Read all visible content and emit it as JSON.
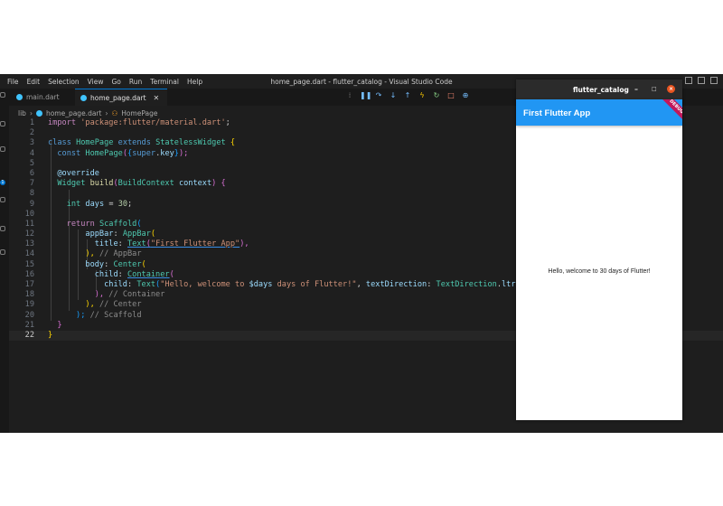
{
  "menu": [
    "File",
    "Edit",
    "Selection",
    "View",
    "Go",
    "Run",
    "Terminal",
    "Help"
  ],
  "window_title": "home_page.dart - flutter_catalog - Visual Studio Code",
  "tabs": [
    {
      "label": "main.dart",
      "icon": "dart-icon"
    },
    {
      "label": "home_page.dart",
      "icon": "dart-icon",
      "active": true
    }
  ],
  "activity_badge": "1",
  "breadcrumb": {
    "folder": "lib",
    "file": "home_page.dart",
    "symbol": "HomePage"
  },
  "editor": {
    "current_line": 22
  },
  "line_numbers": [
    "1",
    "2",
    "3",
    "4",
    "5",
    "6",
    "7",
    "8",
    "9",
    "10",
    "11",
    "12",
    "13",
    "14",
    "15",
    "16",
    "17",
    "18",
    "19",
    "20",
    "21",
    "22"
  ],
  "code_tokens": {
    "l1": [
      "import",
      "'package:flutter/material.dart'",
      ";"
    ],
    "l3": [
      "class",
      "HomePage",
      "extends",
      "StatelessWidget",
      "{"
    ],
    "l4": [
      "const",
      "HomePage",
      "(",
      "{",
      "super",
      ".",
      "key",
      "}",
      ");"
    ],
    "l6": [
      "@override"
    ],
    "l7": [
      "Widget",
      "build",
      "(",
      "BuildContext",
      "context",
      ")",
      "{"
    ],
    "l9": [
      "int",
      "days",
      "=",
      "30",
      ";"
    ],
    "l11": [
      "return",
      "Scaffold",
      "("
    ],
    "l12": [
      "appBar",
      ":",
      "AppBar",
      "("
    ],
    "l13": [
      "title",
      ":",
      "Text",
      "(",
      "\"First Flutter App\"",
      "),"
    ],
    "l14": [
      "),",
      "// AppBar"
    ],
    "l15": [
      "body",
      ":",
      "Center",
      "("
    ],
    "l16": [
      "child",
      ":",
      "Container",
      "("
    ],
    "l17": [
      "child",
      ":",
      "Text",
      "(",
      "\"Hello, welcome to ",
      "$days",
      " days of Flutter!\"",
      ", ",
      "textDirection",
      ": ",
      "TextDirection",
      ".",
      "ltr",
      ",),"
    ],
    "l18": [
      "),",
      "// Container"
    ],
    "l19": [
      "),",
      "// Center"
    ],
    "l20": [
      ");",
      "// Scaffold"
    ],
    "l21": [
      "}"
    ],
    "l22": [
      "}"
    ]
  },
  "flutter_window": {
    "title": "flutter_catalog",
    "controls": {
      "minimize": "–",
      "maximize": "□",
      "close": "×"
    },
    "appbar_title": "First Flutter App",
    "banner": "DEBUG",
    "body_text": "Hello, welcome to 30 days of Flutter!"
  },
  "colors": {
    "appbar": "#2196f3",
    "editor_bg": "#1e1e1e",
    "accent": "#0078d4",
    "debug_banner": "#c2185b"
  }
}
